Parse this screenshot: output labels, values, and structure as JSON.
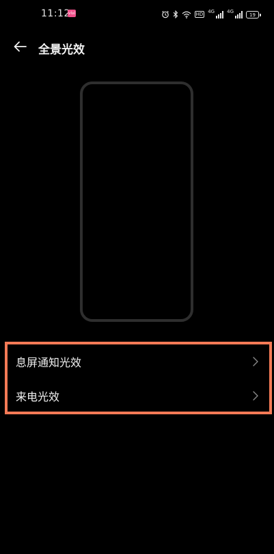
{
  "status_bar": {
    "time": "11:12",
    "app_badge_text": "vivi",
    "hd_label": "HD",
    "net_label_1": "4G",
    "net_label_2": "4G",
    "battery_level": "19"
  },
  "header": {
    "title": "全景光效"
  },
  "settings": {
    "items": [
      {
        "label": "息屏通知光效"
      },
      {
        "label": "来电光效"
      }
    ]
  },
  "colors": {
    "background": "#000000",
    "highlight_border": "#f47a56",
    "phone_outline": "#2e2e2e"
  }
}
